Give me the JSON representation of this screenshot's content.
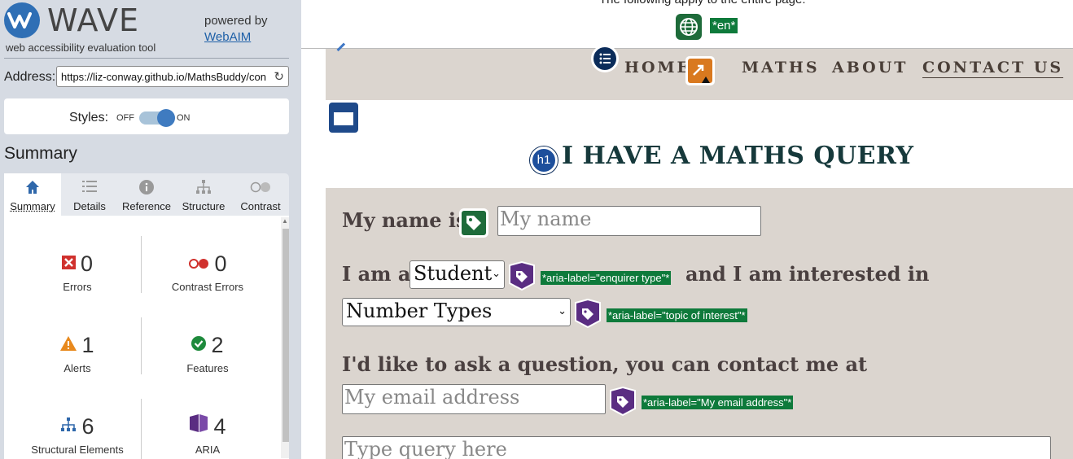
{
  "wave": {
    "logo_text": "WAVE",
    "tagline": "web accessibility evaluation tool",
    "powered_by": "powered by",
    "webaim_link": "WebAIM",
    "address_label": "Address:",
    "address_value": "https://liz-conway.github.io/MathsBuddy/contact.html",
    "styles_label": "Styles:",
    "styles_off": "OFF",
    "styles_on": "ON",
    "styles_state": "on",
    "summary_title": "Summary",
    "tabs": [
      {
        "label": "Summary",
        "icon": "home-icon",
        "active": true
      },
      {
        "label": "Details",
        "icon": "list-icon",
        "active": false
      },
      {
        "label": "Reference",
        "icon": "info-icon",
        "active": false
      },
      {
        "label": "Structure",
        "icon": "hierarchy-icon",
        "active": false
      },
      {
        "label": "Contrast",
        "icon": "contrast-icon",
        "active": false
      }
    ],
    "stats": [
      {
        "count": "0",
        "label": "Errors",
        "icon": "error-icon",
        "color": "#d0312d"
      },
      {
        "count": "0",
        "label": "Contrast Errors",
        "icon": "contrast-error-icon",
        "color": "#d0312d"
      },
      {
        "count": "1",
        "label": "Alerts",
        "icon": "alert-icon",
        "color": "#e8891d"
      },
      {
        "count": "2",
        "label": "Features",
        "icon": "feature-icon",
        "color": "#1e8a3c"
      },
      {
        "count": "6",
        "label": "Structural Elements",
        "icon": "structure-icon",
        "color": "#2e67aa"
      },
      {
        "count": "4",
        "label": "ARIA",
        "icon": "aria-icon",
        "color": "#5a2d82"
      }
    ]
  },
  "site": {
    "lang_note": "The following apply to the entire page:",
    "lang_tag": "*en*",
    "nav": [
      "HOME",
      "MATHS",
      "ABOUT",
      "CONTACT US"
    ],
    "h1_badge": "h1",
    "heading": "I HAVE A MATHS QUERY",
    "form": {
      "name_label": "My name is",
      "name_placeholder": "My name",
      "iam_label": "I am a",
      "enquirer_value": "Student",
      "enquirer_aria": "*aria-label=\"enquirer type\"*",
      "interested_label": "and I am interested in",
      "topic_value": "Number Types",
      "topic_aria": "*aria-label=\"topic of interest\"*",
      "contact_label": "I'd like to ask a question, you can contact me at",
      "email_placeholder": "My email address",
      "email_aria": "*aria-label=\"My email address\"*",
      "query_placeholder": "Type query here"
    }
  }
}
